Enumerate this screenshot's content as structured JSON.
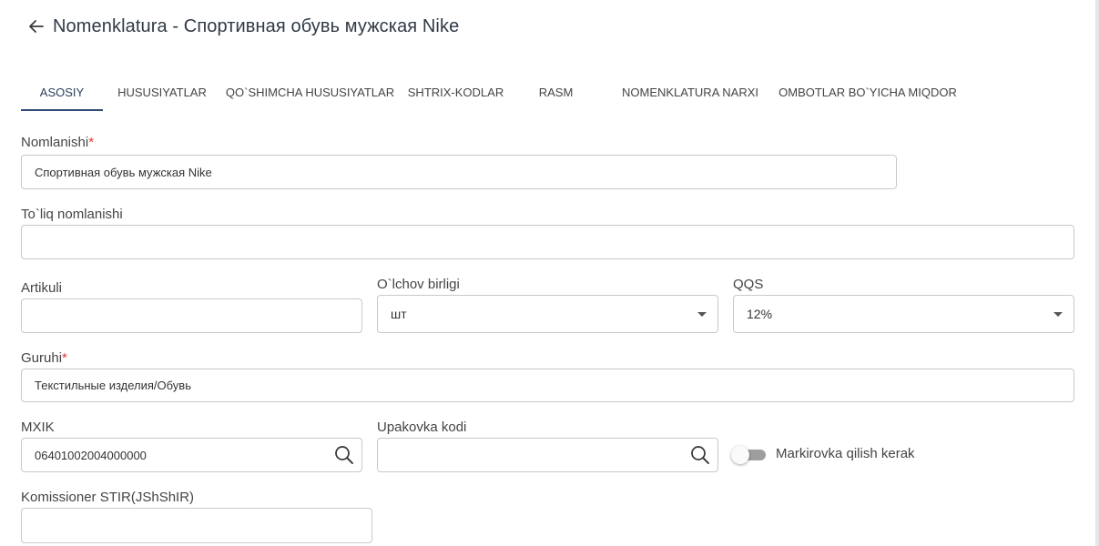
{
  "header": {
    "title": "Nomenklatura - Спортивная обувь мужская Nike",
    "back_icon": "arrow-left-icon"
  },
  "tabs": [
    {
      "label": "ASOSIY",
      "active": true
    },
    {
      "label": "HUSUSIYATLAR",
      "active": false
    },
    {
      "label": "QO`SHIMCHA HUSUSIYATLAR",
      "active": false
    },
    {
      "label": "SHTRIX-KODLAR",
      "active": false
    },
    {
      "label": "RASM",
      "active": false
    },
    {
      "label": "NOMENKLATURA NARXI",
      "active": false
    },
    {
      "label": "OMBOTLAR BO`YICHA MIQDOR",
      "active": false
    }
  ],
  "form": {
    "name": {
      "label": "Nomlanishi",
      "required_mark": "*",
      "value": "Спортивная обувь мужская Nike"
    },
    "full_name": {
      "label": "To`liq nomlanishi",
      "value": ""
    },
    "article": {
      "label": "Artikuli",
      "value": ""
    },
    "unit": {
      "label": "O`lchov birligi",
      "value": "шт"
    },
    "vat": {
      "label": "QQS",
      "value": "12%"
    },
    "group": {
      "label": "Guruhi",
      "required_mark": "*",
      "value": "Текстильные изделия/Обувь"
    },
    "mxik": {
      "label": "MXIK",
      "value": "06401002004000000"
    },
    "package_code": {
      "label": "Upakovka kodi",
      "value": ""
    },
    "marking": {
      "label": "Markirovka qilish kerak",
      "enabled": false
    },
    "commissioner": {
      "label": "Komissioner STIR(JShShIR)",
      "value": ""
    }
  },
  "icons": {
    "search": "search-icon",
    "dropdown": "chevron-down-icon"
  },
  "colors": {
    "accent": "#2f4a73",
    "required": "#e53935",
    "border": "#c9c9c9"
  }
}
